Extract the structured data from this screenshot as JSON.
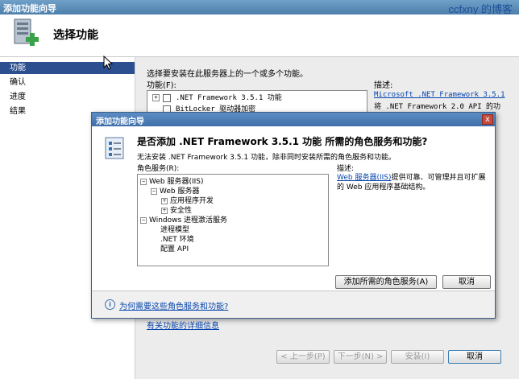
{
  "window": {
    "title": "添加功能向导",
    "watermark": "ccfxny 的博客"
  },
  "header": {
    "title": "选择功能"
  },
  "nav": {
    "items": [
      "功能",
      "确认",
      "进度",
      "结果"
    ],
    "active_index": 0
  },
  "main": {
    "instruction": "选择要安装在此服务器上的一个或多个功能。",
    "features_label": "功能(F):",
    "features": [
      {
        "expander": "+",
        "label": ".NET Framework 3.5.1 功能"
      },
      {
        "expander": "",
        "label": "BitLocker 驱动器加密"
      }
    ],
    "description_label": "描述:",
    "description_link": "Microsoft .NET Framework 3.5.1",
    "description_text": "将 .NET Framework 2.0 API 的功",
    "more_info_link": "有关功能的详细信息"
  },
  "footer_buttons": {
    "prev": "< 上一步(P)",
    "next": "下一步(N) >",
    "install": "安装(I)",
    "cancel": "取消"
  },
  "dialog": {
    "title": "添加功能向导",
    "close_glyph": "x",
    "heading": "是否添加 .NET Framework 3.5.1 功能 所需的角色服务和功能?",
    "subtext": "无法安装 .NET Framework 3.5.1 功能，除非同时安装所需的角色服务和功能。",
    "roles_label": "角色服务(R):",
    "tree": [
      {
        "level": 0,
        "expander": "−",
        "label": "Web 服务器(IIS)"
      },
      {
        "level": 1,
        "expander": "−",
        "label": "Web 服务器"
      },
      {
        "level": 2,
        "expander": "+",
        "label": "应用程序开发"
      },
      {
        "level": 2,
        "expander": "+",
        "label": "安全性"
      },
      {
        "level": 0,
        "expander": "−",
        "label": "Windows 进程激活服务"
      },
      {
        "level": 1,
        "expander": "",
        "label": "进程模型"
      },
      {
        "level": 1,
        "expander": "",
        "label": ".NET 环境"
      },
      {
        "level": 1,
        "expander": "",
        "label": "配置 API"
      }
    ],
    "description_label": "描述:",
    "description_link": "Web 服务器(IIS)",
    "description_text": "提供可靠、可管理并且可扩展的 Web 应用程序基础结构。",
    "add_button": "添加所需的角色服务(A)",
    "cancel_button": "取消",
    "why_link": "为何需要这些角色服务和功能?"
  }
}
